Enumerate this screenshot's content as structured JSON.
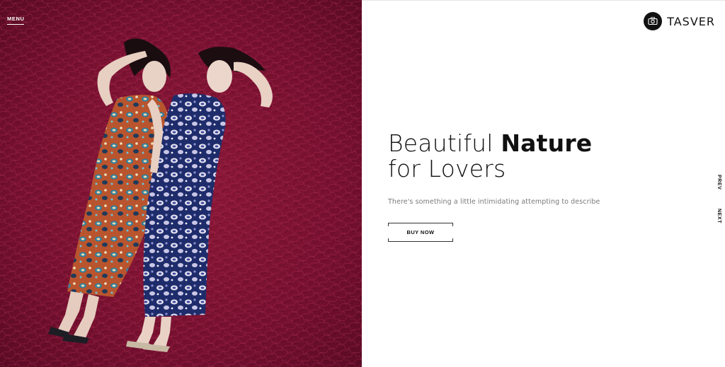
{
  "nav": {
    "menu_label": "MENU"
  },
  "brand": {
    "name": "TASVER",
    "logo_icon": "camera-icon"
  },
  "hero": {
    "headline_light": "Beautiful ",
    "headline_bold": "Nature",
    "headline_line2": "for Lovers",
    "subtitle": "There's something a little intimidating attempting to describe",
    "cta_label": "BUY NOW",
    "image_description_icon": "hero-photo"
  },
  "slider": {
    "prev_label": "PREV",
    "next_label": "NEXT"
  },
  "colors": {
    "hero_background": "#7a1030",
    "text_dark": "#111111",
    "text_muted": "#7a7a7a"
  }
}
